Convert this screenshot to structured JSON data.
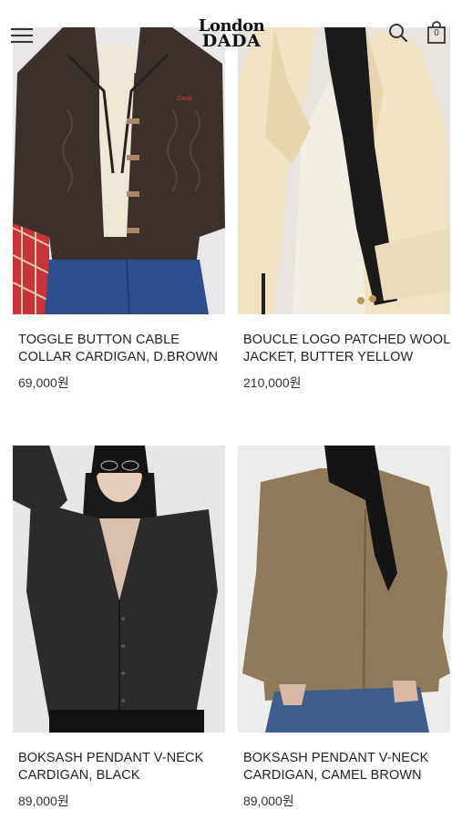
{
  "header": {
    "logo_line1": "London",
    "logo_line2": "DADA",
    "cart_count": "0",
    "menu_icon": "hamburger-menu-icon",
    "search_icon": "search-icon",
    "cart_icon": "shopping-bag-icon"
  },
  "products": [
    {
      "name": "TOGGLE BUTTON CABLE COLLAR CARDIGAN, D.BROWN",
      "price": "69,000원",
      "colors": {
        "bg": "#e9e7e8",
        "garment": "#3b302b",
        "accent": "#2d4e8f"
      }
    },
    {
      "name": "BOUCLE LOGO PATCHED WOOL JACKET, BUTTER YELLOW",
      "price": "210,000원",
      "colors": {
        "bg": "#e7e4df",
        "garment": "#efe3c2",
        "accent": "#1a1a1a"
      }
    },
    {
      "name": "BOKSASH PENDANT V-NECK CARDIGAN, BLACK",
      "price": "89,000원",
      "colors": {
        "bg": "#e6e6e6",
        "garment": "#2b2b2b",
        "accent": "#111111"
      }
    },
    {
      "name": "BOKSASH PENDANT V-NECK CARDIGAN, CAMEL BROWN",
      "price": "89,000원",
      "colors": {
        "bg": "#ececea",
        "garment": "#8e7b5a",
        "accent": "#3f5e8c"
      }
    }
  ]
}
